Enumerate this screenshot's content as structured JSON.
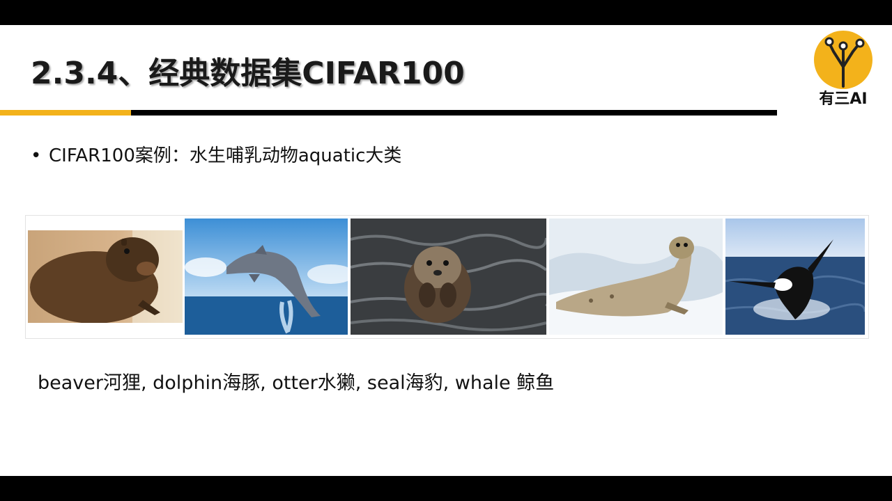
{
  "slide": {
    "title": "2.3.4、经典数据集CIFAR100",
    "logo_text": "有三AI",
    "bullet_marker": "•",
    "bullet": "CIFAR100案例：水生哺乳动物aquatic大类",
    "caption": "beaver河狸, dolphin海豚, otter水獭, seal海豹, whale 鲸鱼",
    "accent_color": "#f3b21b"
  },
  "images": [
    {
      "icon": "beaver-photo"
    },
    {
      "icon": "dolphin-photo"
    },
    {
      "icon": "otter-photo"
    },
    {
      "icon": "seal-photo"
    },
    {
      "icon": "whale-photo"
    }
  ]
}
